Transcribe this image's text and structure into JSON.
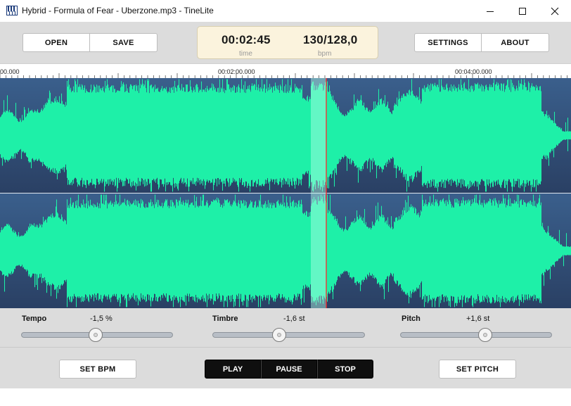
{
  "window": {
    "title": "Hybrid - Formula of Fear - Uberzone.mp3 - TineLite",
    "icon": "piano-keys-icon"
  },
  "toolbar": {
    "open_label": "OPEN",
    "save_label": "SAVE",
    "settings_label": "SETTINGS",
    "about_label": "ABOUT"
  },
  "display": {
    "time_value": "00:02:45",
    "time_label": "time",
    "bpm_value": "130/128,0",
    "bpm_label": "bpm"
  },
  "ruler": {
    "labels": [
      "00.000",
      "00:02:00.000",
      "00:04:00.000"
    ]
  },
  "waveform": {
    "colors": {
      "background_top": "#3a5f8c",
      "background_bottom": "#2a4064",
      "wave": "#1ef0a8",
      "selection": "#b8ffe8",
      "playhead": "#ff2a2a"
    },
    "channels": 2
  },
  "controls": {
    "tempo": {
      "label": "Tempo",
      "value": "-1,5 %",
      "level": 0.49
    },
    "timbre": {
      "label": "Timbre",
      "value": "-1,6 st",
      "level": 0.44
    },
    "pitch": {
      "label": "Pitch",
      "value": "+1,6 st",
      "level": 0.56
    }
  },
  "bottom": {
    "set_bpm_label": "SET BPM",
    "play_label": "PLAY",
    "pause_label": "PAUSE",
    "stop_label": "STOP",
    "set_pitch_label": "SET PITCH"
  }
}
